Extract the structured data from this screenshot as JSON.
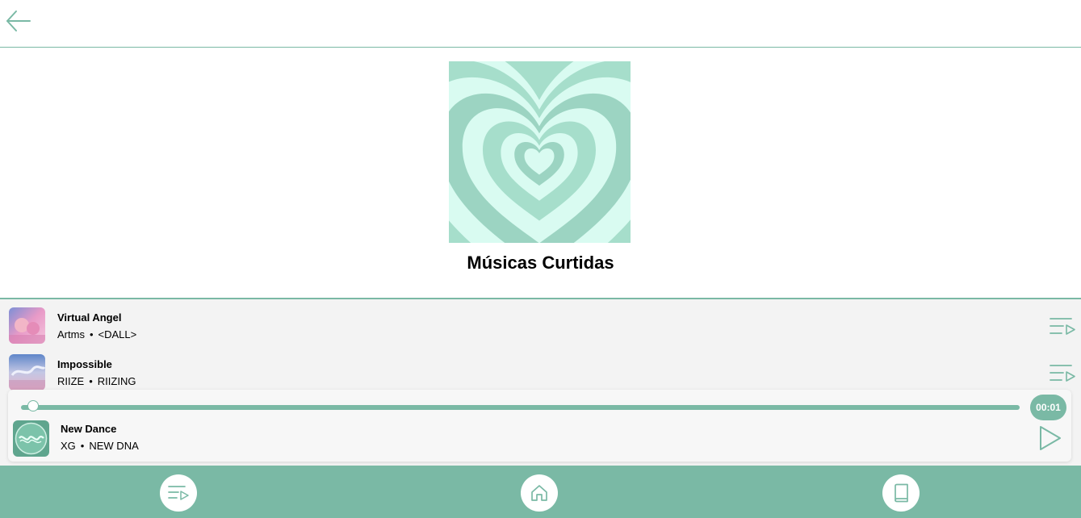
{
  "header": {
    "back_icon": "arrow-left-icon"
  },
  "playlist": {
    "cover_icon": "concentric-hearts-cover",
    "title": "Músicas Curtidas"
  },
  "tracks": [
    {
      "title": "Virtual Angel",
      "artist": "Artms",
      "separator": "•",
      "album": "<DALL>",
      "action_icon": "add-to-queue-icon"
    },
    {
      "title": "Impossible",
      "artist": "RIIZE",
      "separator": "•",
      "album": "RIIZING",
      "action_icon": "add-to-queue-icon"
    }
  ],
  "player": {
    "title": "New Dance",
    "artist": "XG",
    "separator": "•",
    "album": "NEW DNA",
    "elapsed": "00:01",
    "progress_fraction": 0.01,
    "play_icon": "play-icon"
  },
  "nav": {
    "items": [
      {
        "icon": "playlist-icon"
      },
      {
        "icon": "home-icon"
      },
      {
        "icon": "book-icon"
      }
    ]
  },
  "colors": {
    "accent": "#7ab9a5",
    "cover_light": "#d9fbf1",
    "cover_mid": "#a6decb",
    "list_bg": "#f3f3f3"
  }
}
